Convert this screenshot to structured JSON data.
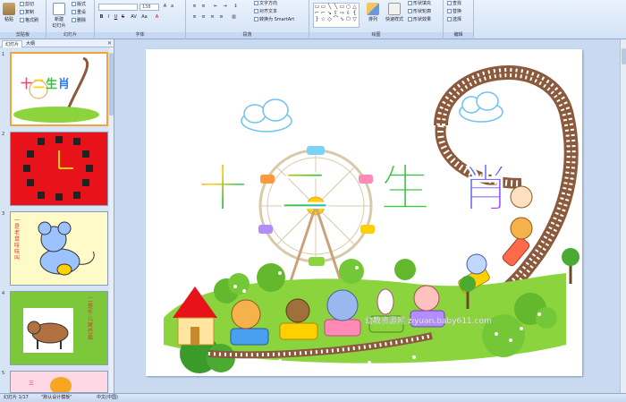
{
  "ribbon": {
    "clipboard": {
      "label": "剪贴板",
      "paste": "粘贴",
      "cut": "剪切",
      "copy": "复制",
      "format_painter": "格式刷"
    },
    "slides": {
      "label": "幻灯片",
      "new_slide": "新建\n幻灯片",
      "layout": "版式",
      "reset": "重设",
      "delete": "删除"
    },
    "font": {
      "label": "字体",
      "font_name": "",
      "font_size": "138"
    },
    "paragraph": {
      "label": "段落",
      "text_direction": "文字方向",
      "align_text": "对齐文本",
      "convert_smartart": "转换为 SmartArt"
    },
    "drawing": {
      "label": "绘图",
      "arrange": "排列",
      "quick_styles": "快速样式",
      "shape_fill": "形状填充",
      "shape_outline": "形状轮廓",
      "shape_effects": "形状效果"
    },
    "editing": {
      "label": "编辑",
      "find": "查找",
      "replace": "替换",
      "select": "选择"
    }
  },
  "left_pane": {
    "tabs": [
      "幻灯片",
      "大纲"
    ],
    "thumbnails": [
      {
        "num": "1",
        "title": "十二生肖"
      },
      {
        "num": "2",
        "title": ""
      },
      {
        "num": "3",
        "title": "一是老鼠吱吱叫"
      },
      {
        "num": "4",
        "title": "二是牛儿尾巴摇"
      },
      {
        "num": "5",
        "title": "三"
      }
    ]
  },
  "slide": {
    "title_chars": [
      "十",
      "二",
      "生",
      "肖"
    ],
    "watermark": "幼教资源网 ziyuan.baby611.com"
  },
  "statusbar": {
    "slide_info": "幻灯片 1/17",
    "theme": "\"默认设计模板\"",
    "language": "中文(中国)"
  },
  "colors": {
    "title_gradient": [
      "#ff3b6b",
      "#ffd000",
      "#36c43f",
      "#2a7bff",
      "#b02cff"
    ],
    "grass": "#8bd43e",
    "track": "#8b5a3c"
  }
}
